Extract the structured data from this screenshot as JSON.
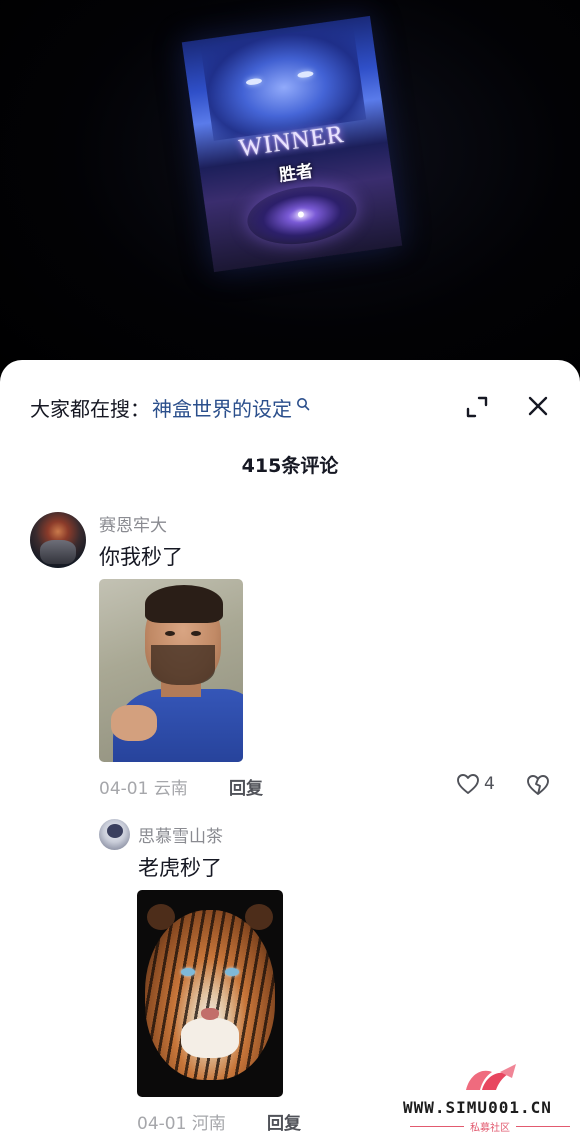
{
  "video": {
    "overlay_title": "WINNER",
    "overlay_subtitle": "胜者"
  },
  "search": {
    "prefix": "大家都在搜：",
    "term": "神盒世界的设定"
  },
  "header": {
    "comment_count": "415条评论"
  },
  "comments": [
    {
      "username": "赛恩牢大",
      "text": "你我秒了",
      "date": "04-01",
      "location": "云南",
      "reply_label": "回复",
      "like_count": "4"
    },
    {
      "username": "思慕雪山茶",
      "text": "老虎秒了",
      "date": "04-01",
      "location": "河南",
      "reply_label": "回复"
    }
  ],
  "watermark": {
    "site": "WWW.SIMU001.CN",
    "sub": "私募社区"
  }
}
